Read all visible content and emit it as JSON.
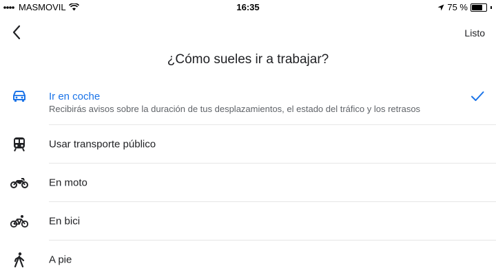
{
  "status_bar": {
    "carrier": "MASMOVIL",
    "time": "16:35",
    "battery_percent": "75 %",
    "battery_level": 0.75,
    "signal_icon": "signal-bars-icon",
    "wifi_icon": "wifi-icon",
    "location_icon": "location-arrow-icon"
  },
  "header": {
    "done_label": "Listo",
    "title": "¿Cómo sueles ir a trabajar?"
  },
  "options": [
    {
      "label": "Ir en coche",
      "description": "Recibirás avisos sobre la duración de tus desplazamientos, el estado del tráfico y los retrasos",
      "icon": "car-icon",
      "selected": true
    },
    {
      "label": "Usar transporte público",
      "icon": "train-icon",
      "selected": false
    },
    {
      "label": "En moto",
      "icon": "motorcycle-icon",
      "selected": false
    },
    {
      "label": "En bici",
      "icon": "bicycle-icon",
      "selected": false
    },
    {
      "label": "A pie",
      "icon": "walking-icon",
      "selected": false
    }
  ],
  "colors": {
    "accent": "#1a73e8",
    "text": "#202124",
    "secondary_text": "#5f6368",
    "divider": "#e6e6e6"
  }
}
